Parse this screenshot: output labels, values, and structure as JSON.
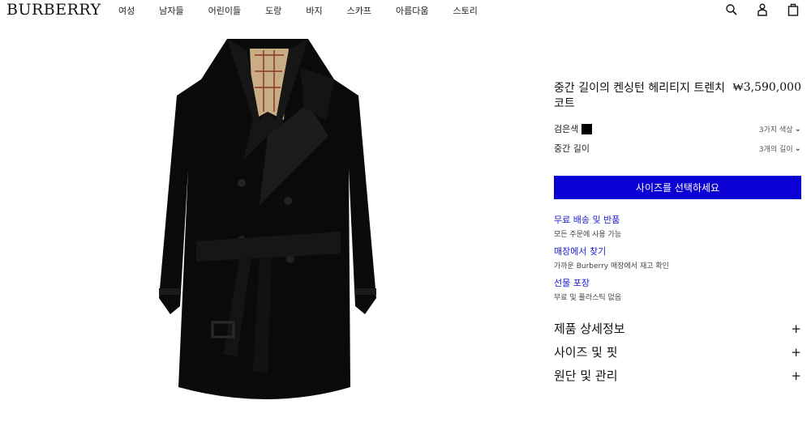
{
  "brand": "BURBERRY",
  "nav": [
    "여성",
    "남자들",
    "어린이들",
    "도랑",
    "바지",
    "스카프",
    "아름다움",
    "스토리"
  ],
  "header_icons": [
    "search-icon",
    "user-icon",
    "shopping-bag-icon"
  ],
  "product": {
    "title": "중간 길이의 켄싱턴 헤리티지 트렌치 코트",
    "price": "₩3,590,000",
    "color_label": "검은색",
    "color_swatch": "#000000",
    "color_options": "3가지 색상",
    "length_label": "중간 길이",
    "length_options": "3개의 길이",
    "select_size": "사이즈를 선택하세요",
    "accent_color": "#0b00d4"
  },
  "services": [
    {
      "title": "무료 배송 및 반품",
      "sub": "모든 주문에 사용 가능"
    },
    {
      "title": "매장에서 찾기",
      "sub": "가까운 Burberry 매장에서 재고 확인"
    },
    {
      "title": "선물 포장",
      "sub": "무료 및 플라스틱 없음"
    }
  ],
  "accordions": [
    {
      "label": "제품 상세정보",
      "icon": "+"
    },
    {
      "label": "사이즈 및 핏",
      "icon": "+"
    },
    {
      "label": "원단 및 관리",
      "icon": "+"
    }
  ]
}
